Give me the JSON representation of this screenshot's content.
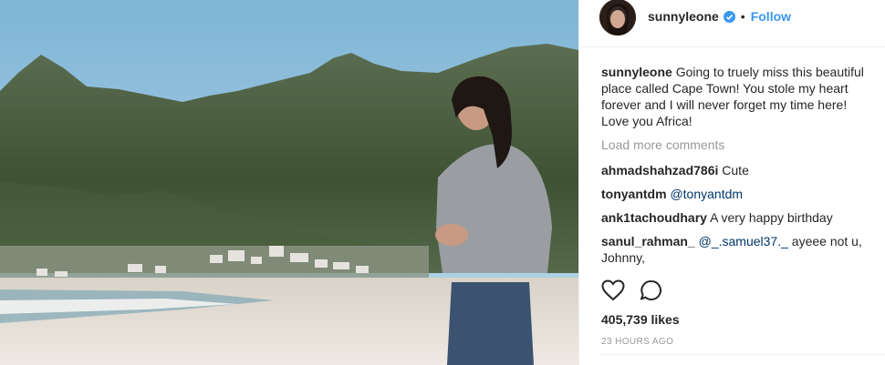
{
  "post": {
    "author": "sunnyleone",
    "follow_label": "Follow",
    "separator": "•",
    "caption": {
      "username": "sunnyleone",
      "text": "Going to truely miss this beautiful place called Cape Town! You stole my heart forever and I will never forget my time here! Love you Africa!"
    },
    "load_more_label": "Load more comments",
    "comments": [
      {
        "username": "ahmadshahzad786i",
        "text": "Cute",
        "mention": ""
      },
      {
        "username": "tonyantdm",
        "text": "",
        "mention": "@tonyantdm"
      },
      {
        "username": "ank1tachoudhary",
        "text": "A very happy birthday",
        "mention": ""
      },
      {
        "username": "sanul_rahman_",
        "mention": "@_.samuel37._",
        "text": "ayeee not u, Johnny,"
      }
    ],
    "likes": "405,739 likes",
    "timestamp": "23 HOURS AGO"
  },
  "icons": {
    "verified": "verified-badge-icon",
    "like": "heart-icon",
    "comment": "comment-bubble-icon"
  },
  "colors": {
    "accent": "#3897f0",
    "text": "#262626",
    "muted": "#999999",
    "mention": "#003569"
  }
}
